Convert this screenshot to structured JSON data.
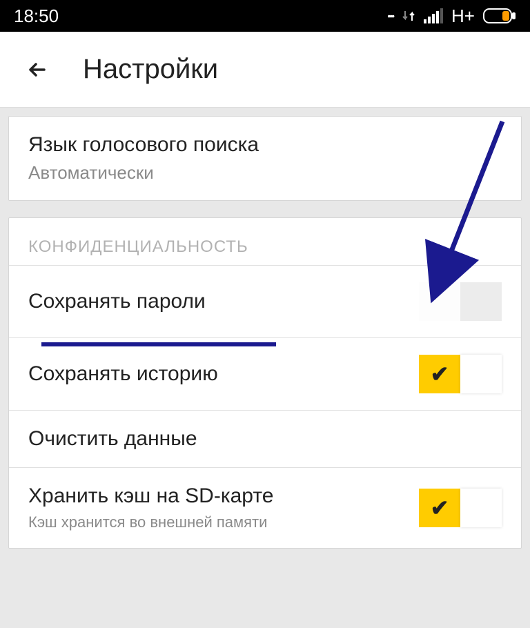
{
  "status_bar": {
    "time": "18:50",
    "network_label": "H+"
  },
  "header": {
    "title": "Настройки"
  },
  "settings": {
    "voice_search": {
      "title": "Язык голосового поиска",
      "value": "Автоматически"
    },
    "privacy_section": "КОНФИДЕНЦИАЛЬНОСТЬ",
    "save_passwords": {
      "title": "Сохранять пароли",
      "enabled": false
    },
    "save_history": {
      "title": "Сохранять историю",
      "enabled": true
    },
    "clear_data": {
      "title": "Очистить данные"
    },
    "cache_sd": {
      "title": "Хранить кэш на SD-карте",
      "subtitle": "Кэш хранится во внешней памяти",
      "enabled": true
    }
  }
}
